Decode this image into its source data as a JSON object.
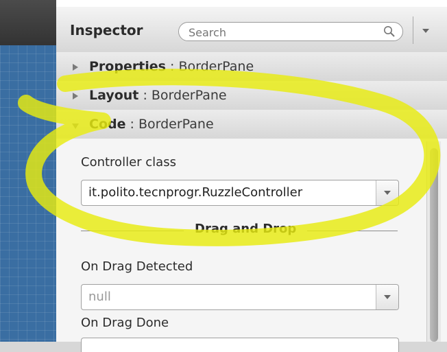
{
  "inspector": {
    "title": "Inspector",
    "search_placeholder": "Search"
  },
  "sections": [
    {
      "name": "Properties",
      "separator": " : ",
      "type": "BorderPane",
      "state": "collapsed"
    },
    {
      "name": "Layout",
      "separator": " : ",
      "type": "BorderPane",
      "state": "collapsed"
    },
    {
      "name": "Code",
      "separator": " : ",
      "type": "BorderPane",
      "state": "expanded"
    }
  ],
  "code": {
    "controller_label": "Controller class",
    "controller_value": "it.polito.tecnprogr.RuzzleController",
    "drag_drop_title": "Drag and Drop",
    "on_drag_detected_label": "On Drag Detected",
    "on_drag_detected_value": "null",
    "on_drag_done_label": "On Drag Done"
  },
  "colors": {
    "highlight": "#e8ec10",
    "canvas": "#3a6ea2"
  }
}
